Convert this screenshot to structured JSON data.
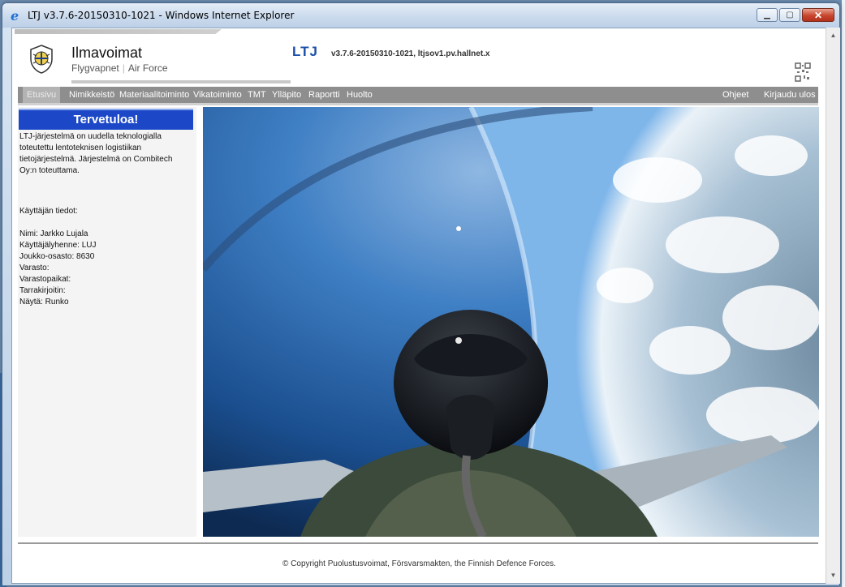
{
  "window": {
    "title": "LTJ v3.7.6-20150310-1021 - Windows Internet Explorer",
    "icon": "ie-icon",
    "buttons": {
      "minimize": "minimize-icon",
      "restore": "restore-icon",
      "close": "close-icon"
    }
  },
  "header": {
    "org_name": "Ilmavoimat",
    "org_sub_1": "Flygvapnet",
    "org_sub_2": "Air Force",
    "app_logo": "LTJ",
    "app_version": "v3.7.6-20150310-1021, ltjsov1.pv.hallnet.x"
  },
  "nav": {
    "items": [
      "Etusivu",
      "Nimikkeistö",
      "Materiaalitoiminto",
      "Vikatoiminto",
      "TMT",
      "Ylläpito",
      "Raportti",
      "Huolto"
    ],
    "right_items": [
      "Ohjeet",
      "Kirjaudu ulos"
    ],
    "active": "Etusivu"
  },
  "sidebar": {
    "welcome": "Tervetuloa!",
    "intro": "LTJ-järjestelmä on uudella teknologialla toteutettu lentoteknisen logistiikan tietojärjestelmä. Järjestelmä on Combitech Oy:n toteuttama.",
    "user_title": "Käyttäjän tiedot:",
    "fields": [
      "Nimi: Jarkko Lujala",
      "Käyttäjälyhenne: LUJ",
      "Joukko-osasto: 8630",
      "Varasto:",
      "Varastopaikat:",
      "Tarrakirjoitin:",
      "Näytä: Runko"
    ]
  },
  "footer": {
    "copyright": "© Copyright Puolustusvoimat, Försvarsmakten, the Finnish Defence Forces."
  },
  "colors": {
    "welcome_bg": "#1c48c8",
    "logo_blue": "#1b4fa8",
    "nav_bg": "#8e8e8e"
  }
}
